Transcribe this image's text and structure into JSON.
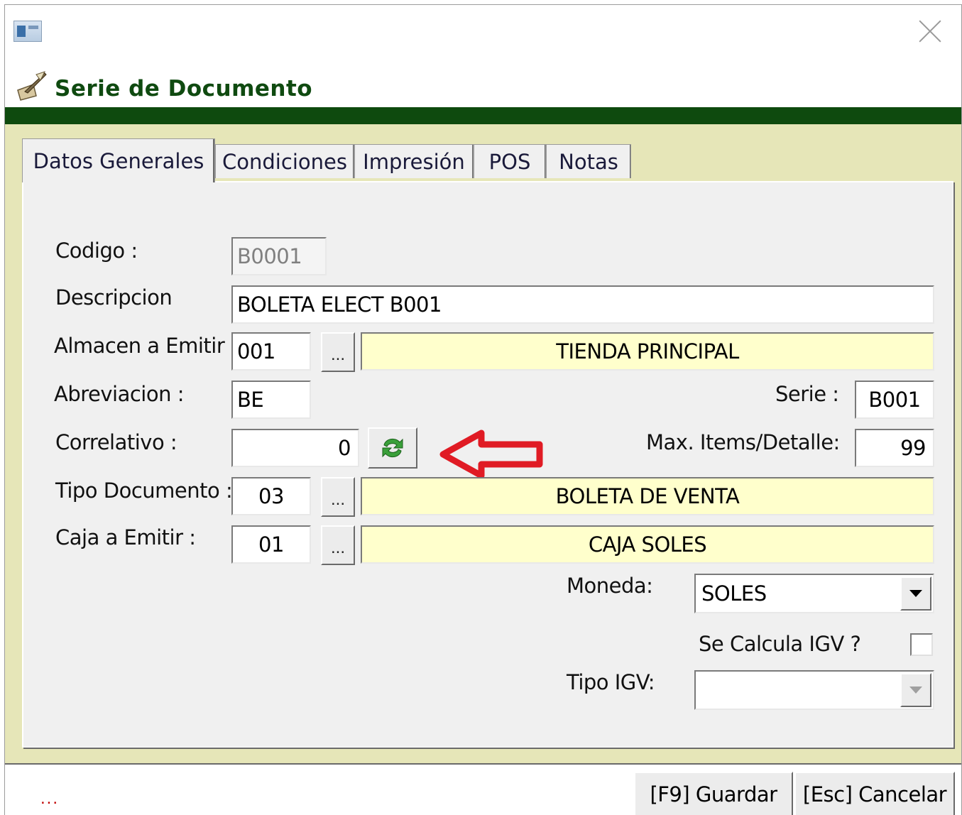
{
  "window": {
    "title": "Serie de Documento",
    "close_glyph": "×",
    "app_icon": "app-window-icon",
    "header_icon": "quill-document-icon"
  },
  "tabs": [
    {
      "label": "Datos Generales",
      "active": true
    },
    {
      "label": "Condiciones",
      "active": false
    },
    {
      "label": "Impresión",
      "active": false
    },
    {
      "label": "POS",
      "active": false
    },
    {
      "label": "Notas",
      "active": false
    }
  ],
  "form": {
    "codigo": {
      "label": "Codigo :",
      "value": "B0001"
    },
    "descripcion": {
      "label": "Descripcion",
      "value": "BOLETA ELECT B001"
    },
    "almacen": {
      "label": "Almacen a Emitir :",
      "code": "001",
      "browse": "...",
      "name": "TIENDA PRINCIPAL"
    },
    "abreviacion": {
      "label": "Abreviacion :",
      "value": "BE"
    },
    "serie": {
      "label": "Serie :",
      "value": "B001"
    },
    "correlativo": {
      "label": "Correlativo :",
      "value": "0",
      "refresh_icon": "refresh-arrows-icon"
    },
    "max_items": {
      "label": "Max. Items/Detalle:",
      "value": "99"
    },
    "tipo_documento": {
      "label": "Tipo Documento :",
      "code": "03",
      "browse": "...",
      "name": "BOLETA DE VENTA"
    },
    "caja": {
      "label": "Caja a Emitir :",
      "code": "01",
      "browse": "...",
      "name": "CAJA SOLES"
    },
    "moneda": {
      "label": "Moneda:",
      "value": "SOLES"
    },
    "calcula_igv": {
      "label": "Se Calcula IGV ?",
      "checked": false
    },
    "tipo_igv": {
      "label": "Tipo IGV:",
      "value": ""
    }
  },
  "annotation": {
    "type": "red-arrow-pointing-left",
    "color": "#e01b24"
  },
  "footer": {
    "status_text": "...",
    "save_label": "[F9] Guardar",
    "cancel_label": "[Esc] Cancelar"
  },
  "colors": {
    "header_text": "#0f4a10",
    "green_bar": "#0e4a0e",
    "body_bg": "#e6e6b8",
    "readonly_yellow": "#ffffcc"
  }
}
